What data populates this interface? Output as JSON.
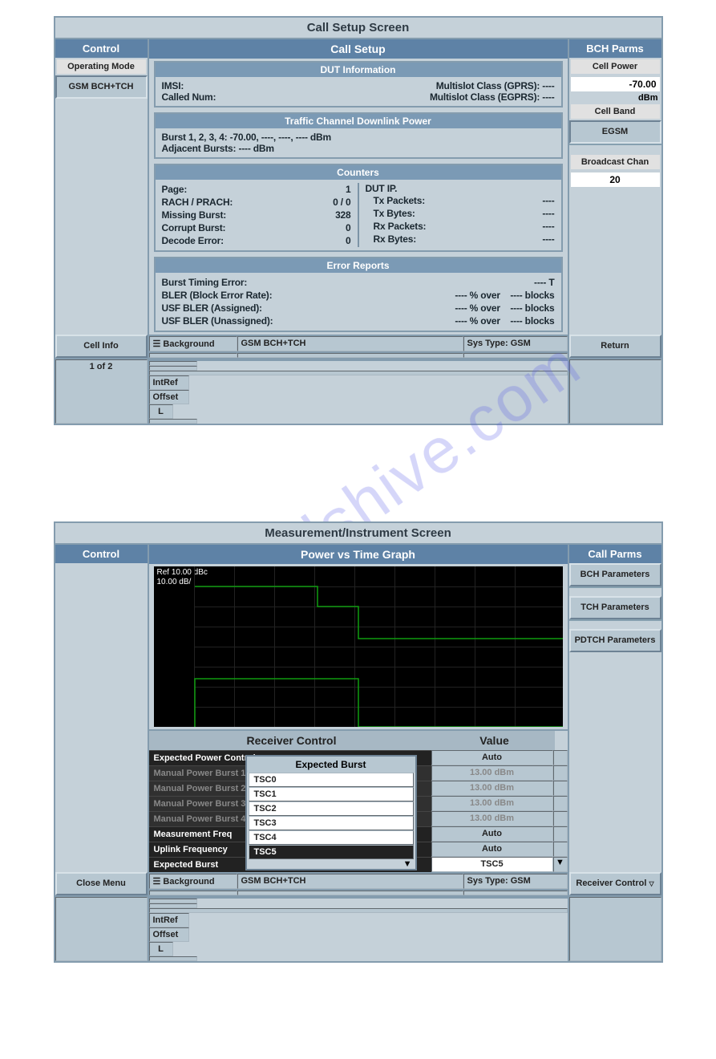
{
  "watermark": "manualshive.com",
  "screen1": {
    "title": "Call Setup Screen",
    "left": {
      "head": "Control",
      "field": "Operating Mode",
      "value": "GSM BCH+TCH",
      "softkey": "Cell Info",
      "pager": "1 of 2"
    },
    "center": {
      "head": "Call Setup",
      "dut": {
        "title": "DUT Information",
        "imsi_l": "IMSI:",
        "called_l": "Called Num:",
        "ms_gprs": "Multislot Class (GPRS):  ----",
        "ms_egprs": "Multislot Class (EGPRS): ----"
      },
      "tcdp": {
        "title": "Traffic Channel Downlink Power",
        "burst": "Burst 1, 2, 3, 4:    -70.00,    ----,    ----,    ---- dBm",
        "adj": "Adjacent Bursts:       ---- dBm"
      },
      "counters": {
        "title": "Counters",
        "left": [
          [
            "Page:",
            "1"
          ],
          [
            "RACH / PRACH:",
            "0 / 0"
          ],
          [
            "Missing Burst:",
            "328"
          ],
          [
            "Corrupt Burst:",
            "0"
          ],
          [
            "Decode Error:",
            "0"
          ]
        ],
        "right_head": "DUT IP.",
        "right": [
          [
            "Tx Packets:",
            "----"
          ],
          [
            "Tx Bytes:",
            "----"
          ],
          [
            "Rx Packets:",
            "----"
          ],
          [
            "Rx Bytes:",
            "----"
          ]
        ]
      },
      "err": {
        "title": "Error Reports",
        "rows": [
          [
            "Burst Timing Error:",
            "---- T"
          ],
          [
            "BLER (Block Error Rate):",
            "---- % over    ---- blocks"
          ],
          [
            "USF BLER (Assigned):",
            "---- % over    ---- blocks"
          ],
          [
            "USF BLER (Unassigned):",
            "---- % over    ---- blocks"
          ]
        ]
      },
      "status": {
        "bg": "Background",
        "mode": "GSM BCH+TCH",
        "sys": "Sys Type: GSM",
        "ref": "IntRef",
        "off": "Offset",
        "l": "L"
      }
    },
    "right": {
      "head": "BCH Parms",
      "cellpower_l": "Cell Power",
      "cellpower_v": "-70.00",
      "dbm": "dBm",
      "cellband_l": "Cell Band",
      "cellband_v": "EGSM",
      "bcast_l": "Broadcast Chan",
      "bcast_v": "20",
      "softkey": "Return"
    }
  },
  "screen2": {
    "title": "Measurement/Instrument Screen",
    "left": {
      "head": "Control",
      "softkey": "Close Menu"
    },
    "center": {
      "head": "Power vs Time Graph",
      "ref": "Ref  10.00 dBc",
      "div": "10.00 dB/",
      "rc_head": "Receiver Control",
      "val_head": "Value",
      "rows": [
        {
          "l": "Expected Power Control",
          "v": "Auto",
          "g": false
        },
        {
          "l": "Manual Power Burst 1",
          "v": "13.00 dBm",
          "g": true
        },
        {
          "l": "Manual Power Burst 2",
          "v": "13.00 dBm",
          "g": true
        },
        {
          "l": "Manual Power Burst 3",
          "v": "13.00 dBm",
          "g": true
        },
        {
          "l": "Manual Power Burst 4",
          "v": "13.00 dBm",
          "g": true
        },
        {
          "l": "Measurement Freq",
          "v": "Auto",
          "g": false
        },
        {
          "l": "Uplink Frequency",
          "v": "Auto",
          "g": false
        },
        {
          "l": "Expected Burst",
          "v": "TSC5",
          "g": false
        }
      ],
      "popup": {
        "title": "Expected Burst",
        "items": [
          "TSC0",
          "TSC1",
          "TSC2",
          "TSC3",
          "TSC4",
          "TSC5"
        ],
        "sel": "TSC5"
      },
      "status": {
        "bg": "Background",
        "mode": "GSM BCH+TCH",
        "sys": "Sys Type: GSM",
        "ref": "IntRef",
        "off": "Offset",
        "l": "L"
      }
    },
    "right": {
      "head": "Call Parms",
      "btns": [
        "BCH Parameters",
        "TCH Parameters",
        "PDTCH Parameters"
      ],
      "softkey": "Receiver Control"
    }
  }
}
